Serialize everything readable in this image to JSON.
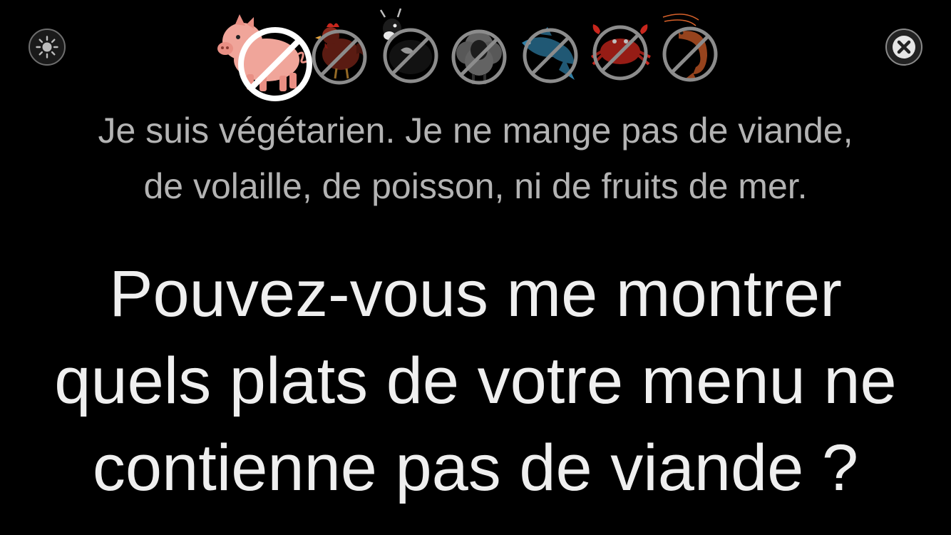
{
  "toolbar": {
    "brightness_icon": "sun-icon",
    "close_icon": "close-x-icon"
  },
  "diet_icons": [
    {
      "name": "pig",
      "crossed": true,
      "selected": true
    },
    {
      "name": "chicken",
      "crossed": true,
      "selected": false
    },
    {
      "name": "cow",
      "crossed": true,
      "selected": false
    },
    {
      "name": "sheep",
      "crossed": true,
      "selected": false
    },
    {
      "name": "fish",
      "crossed": true,
      "selected": false
    },
    {
      "name": "crab",
      "crossed": true,
      "selected": false
    },
    {
      "name": "shrimp",
      "crossed": true,
      "selected": false
    }
  ],
  "statement": {
    "line1": "Je suis végétarien. Je ne mange pas de viande,",
    "line2": "de volaille, de poisson, ni de fruits de mer."
  },
  "question": {
    "line1": "Pouvez-vous me montrer",
    "line2": "quels plats de votre menu ne",
    "line3": "contienne pas de viande ?"
  },
  "colors": {
    "background": "#000000",
    "statement_text": "#b3b3b3",
    "question_text": "#efefef",
    "pig": "#f0a59a",
    "chicken": "#8b2a1c",
    "fish": "#2f7fa6",
    "crab": "#c8261d",
    "shrimp": "#d7612a"
  }
}
